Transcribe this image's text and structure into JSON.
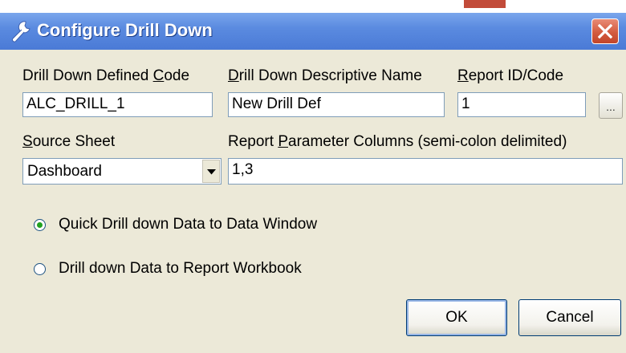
{
  "window": {
    "title": "Configure Drill Down",
    "icon": "wrench-icon",
    "close_icon": "close-icon"
  },
  "fields": {
    "defined_code": {
      "label_pre": "Drill Down Defined ",
      "label_key": "C",
      "label_post": "ode",
      "value": "ALC_DRILL_1"
    },
    "descriptive_name": {
      "label_pre": "",
      "label_key": "D",
      "label_post": "rill Down Descriptive Name",
      "value": "New Drill Def"
    },
    "report_id": {
      "label_pre": "",
      "label_key": "R",
      "label_post": "eport ID/Code",
      "value": "1",
      "browse_label": "..."
    },
    "source_sheet": {
      "label_pre": "",
      "label_key": "S",
      "label_post": "ource Sheet",
      "value": "Dashboard"
    },
    "param_columns": {
      "label_pre": "Report ",
      "label_key": "P",
      "label_post": "arameter Columns (semi-colon delimited)",
      "value": "1,3"
    }
  },
  "options": [
    {
      "label": "Quick Drill down Data to Data Window",
      "checked": true
    },
    {
      "label": "Drill down Data to Report Workbook",
      "checked": false
    }
  ],
  "buttons": {
    "ok": "OK",
    "cancel": "Cancel"
  },
  "colors": {
    "titlebar": "#5b8be0",
    "dialog_bg": "#ece9d8",
    "close_button": "#d35b3f"
  }
}
